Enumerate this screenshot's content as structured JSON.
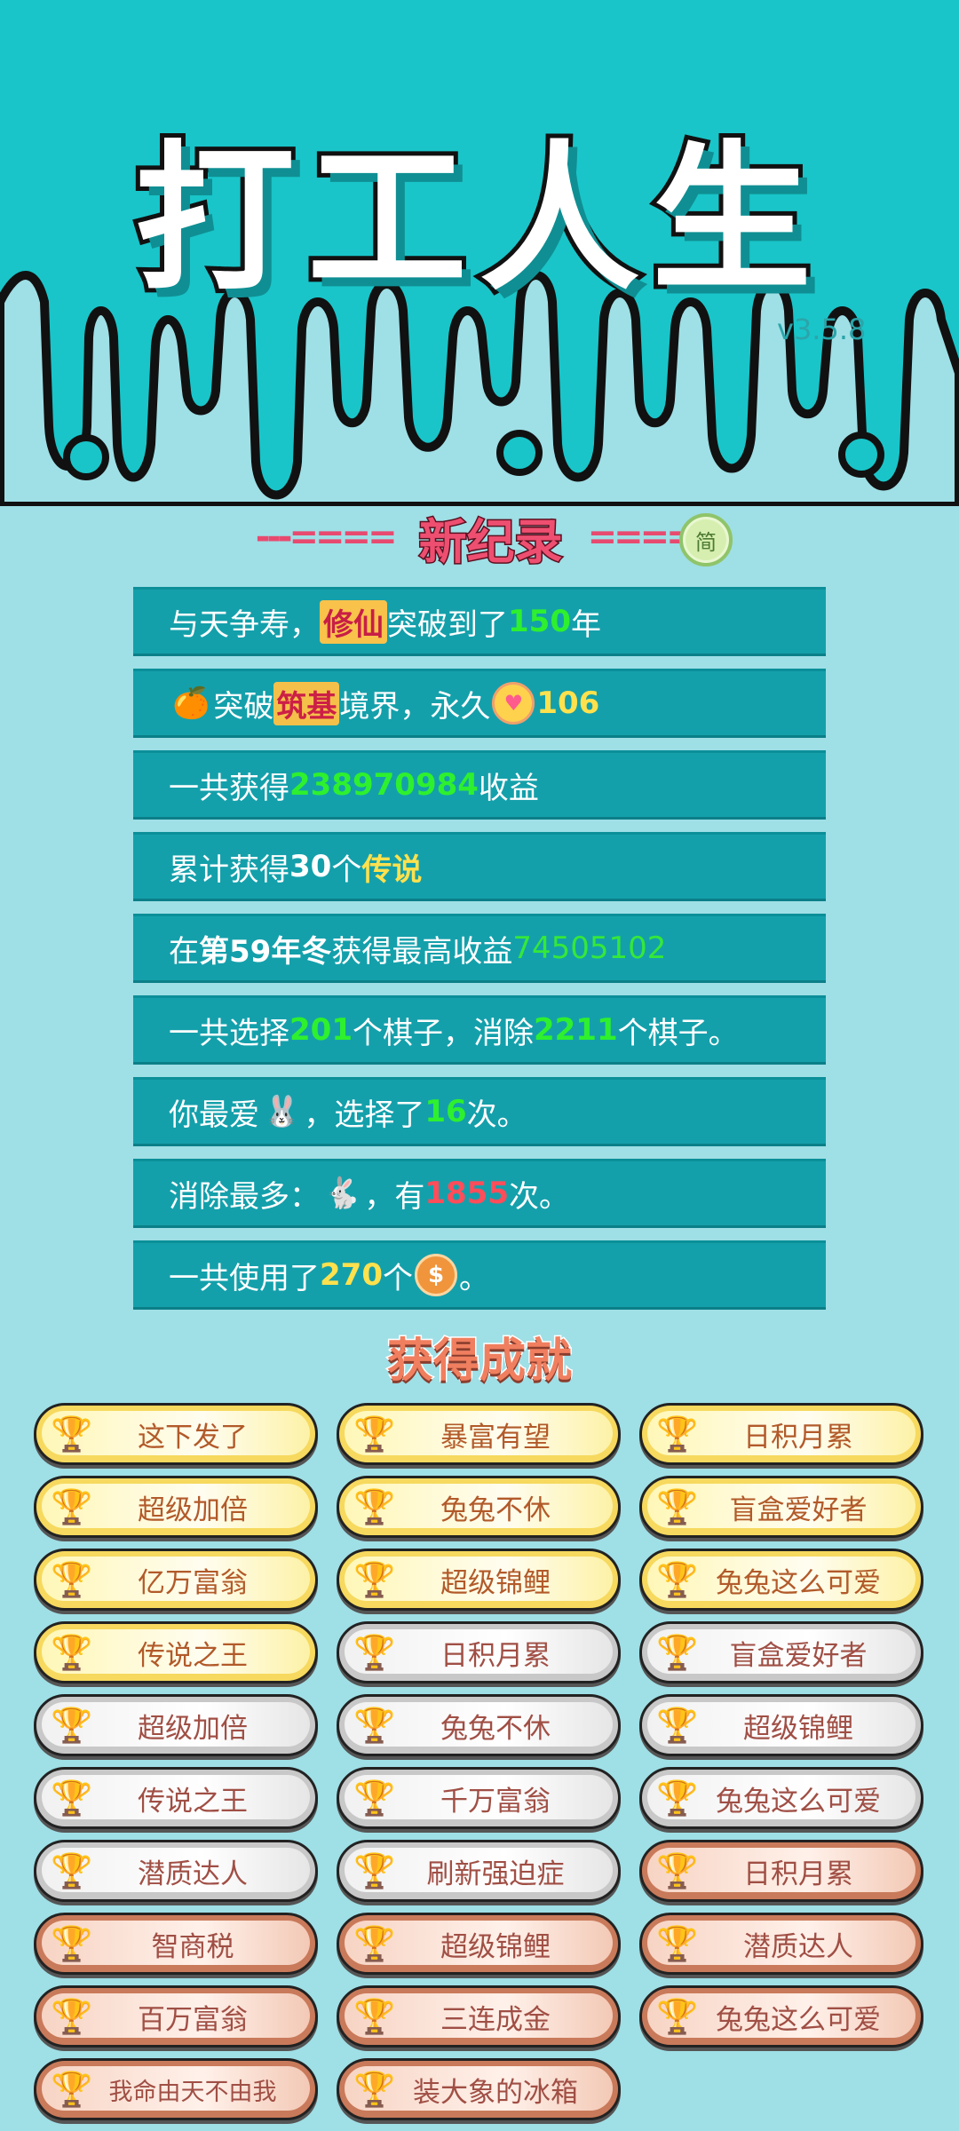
{
  "header": {
    "game_title": "打工人生",
    "version": "v3.5.8"
  },
  "record": {
    "title": "新纪录",
    "deco_left": "---====",
    "deco_right": "====-",
    "simplified_badge": "简"
  },
  "stats": [
    {
      "a": "与天争寿，",
      "hl": "修仙",
      "b": "突破到了",
      "num": "150",
      "c": "年"
    },
    {
      "icon": "🍊",
      "a": "突破",
      "hl": "筑基",
      "b": "境界，永久",
      "num": "106"
    },
    {
      "a": "一共获得",
      "num": "238970984",
      "b": "收益"
    },
    {
      "a": "累计获得",
      "num": "30",
      "b": "个",
      "hl": "传说"
    },
    {
      "a": "在 ",
      "bold": "第59年冬",
      "b": " 获得最高收益",
      "num": "74505102"
    },
    {
      "a": "一共选择",
      "num": "201",
      "b": "个棋子，消除",
      "num2": "2211",
      "c": "个棋子。"
    },
    {
      "a": "你最爱",
      "icon": "🐰",
      "b": "，选择了",
      "num": "16",
      "c": "次。"
    },
    {
      "a": "消除最多：",
      "icon": "🐇",
      "b": "，有",
      "num": "1855",
      "c": "次。"
    },
    {
      "a": "一共使用了",
      "num": "270",
      "b": "个",
      "coin": "$",
      "c": "。"
    }
  ],
  "achievements": {
    "title": "获得成就",
    "items": [
      {
        "label": "这下发了",
        "tier": "gold"
      },
      {
        "label": "暴富有望",
        "tier": "gold"
      },
      {
        "label": "日积月累",
        "tier": "gold"
      },
      {
        "label": "超级加倍",
        "tier": "gold"
      },
      {
        "label": "兔兔不休",
        "tier": "gold"
      },
      {
        "label": "盲盒爱好者",
        "tier": "gold"
      },
      {
        "label": "亿万富翁",
        "tier": "gold"
      },
      {
        "label": "超级锦鲤",
        "tier": "gold"
      },
      {
        "label": "兔兔这么可爱",
        "tier": "gold"
      },
      {
        "label": "传说之王",
        "tier": "gold"
      },
      {
        "label": "日积月累",
        "tier": "silver"
      },
      {
        "label": "盲盒爱好者",
        "tier": "silver"
      },
      {
        "label": "超级加倍",
        "tier": "silver"
      },
      {
        "label": "兔兔不休",
        "tier": "silver"
      },
      {
        "label": "超级锦鲤",
        "tier": "silver"
      },
      {
        "label": "传说之王",
        "tier": "silver"
      },
      {
        "label": "千万富翁",
        "tier": "silver"
      },
      {
        "label": "兔兔这么可爱",
        "tier": "silver"
      },
      {
        "label": "潜质达人",
        "tier": "silver"
      },
      {
        "label": "刷新强迫症",
        "tier": "silver"
      },
      {
        "label": "日积月累",
        "tier": "bronze"
      },
      {
        "label": "智商税",
        "tier": "bronze"
      },
      {
        "label": "超级锦鲤",
        "tier": "bronze"
      },
      {
        "label": "潜质达人",
        "tier": "bronze"
      },
      {
        "label": "百万富翁",
        "tier": "bronze"
      },
      {
        "label": "三连成金",
        "tier": "bronze"
      },
      {
        "label": "兔兔这么可爱",
        "tier": "bronze"
      },
      {
        "label": "我命由天不由我",
        "tier": "bronze"
      },
      {
        "label": "装大象的冰箱",
        "tier": "bronze"
      }
    ]
  },
  "icons": {
    "trophy": "trophy-icon",
    "coin": "coin-icon",
    "heart": "heart-icon",
    "fruit": "fruit-icon",
    "rabbit": "rabbit-icon"
  },
  "colors": {
    "header_bg": "#19c5c9",
    "page_bg": "#9fdfe6",
    "row_bg": "#14a0ab",
    "green": "#2ef02e",
    "yellow": "#ffe14d",
    "red": "#ff4d5a"
  }
}
